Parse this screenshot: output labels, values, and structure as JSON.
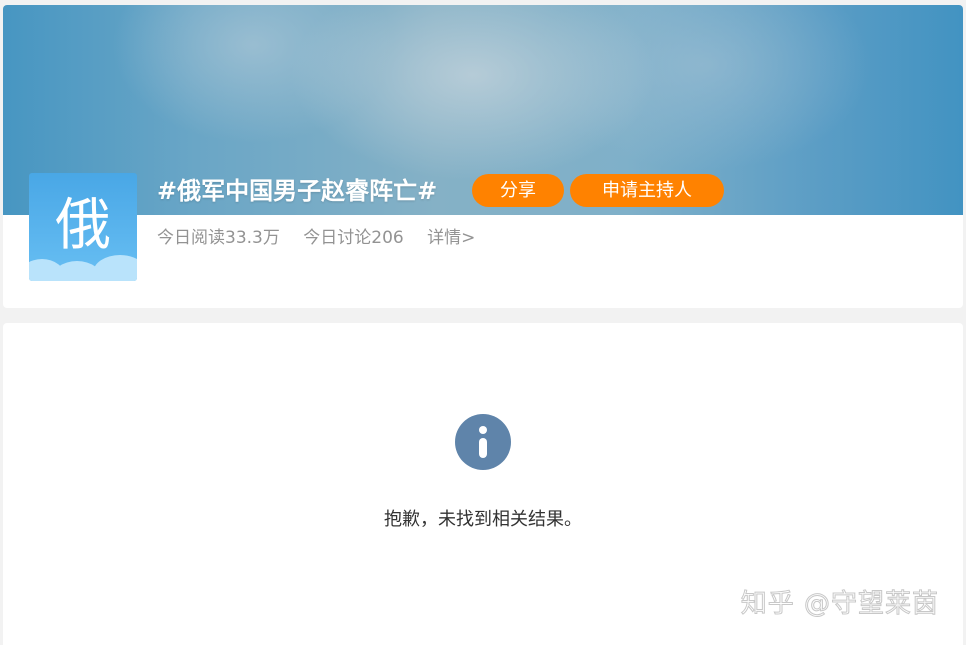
{
  "topic": {
    "avatar_char": "俄",
    "title": "#俄军中国男子赵睿阵亡#",
    "share_label": "分享",
    "host_label": "申请主持人",
    "stats": {
      "reads": "今日阅读33.3万",
      "discussions": "今日讨论206",
      "details": "详情>"
    }
  },
  "result": {
    "icon": "info-icon",
    "message": "抱歉，未找到相关结果。"
  },
  "watermark": "知乎 @守望莱茵",
  "colors": {
    "accent_orange": "#ff8200",
    "info_icon": "#5f84aa",
    "avatar_blue": "#49a7e6"
  }
}
